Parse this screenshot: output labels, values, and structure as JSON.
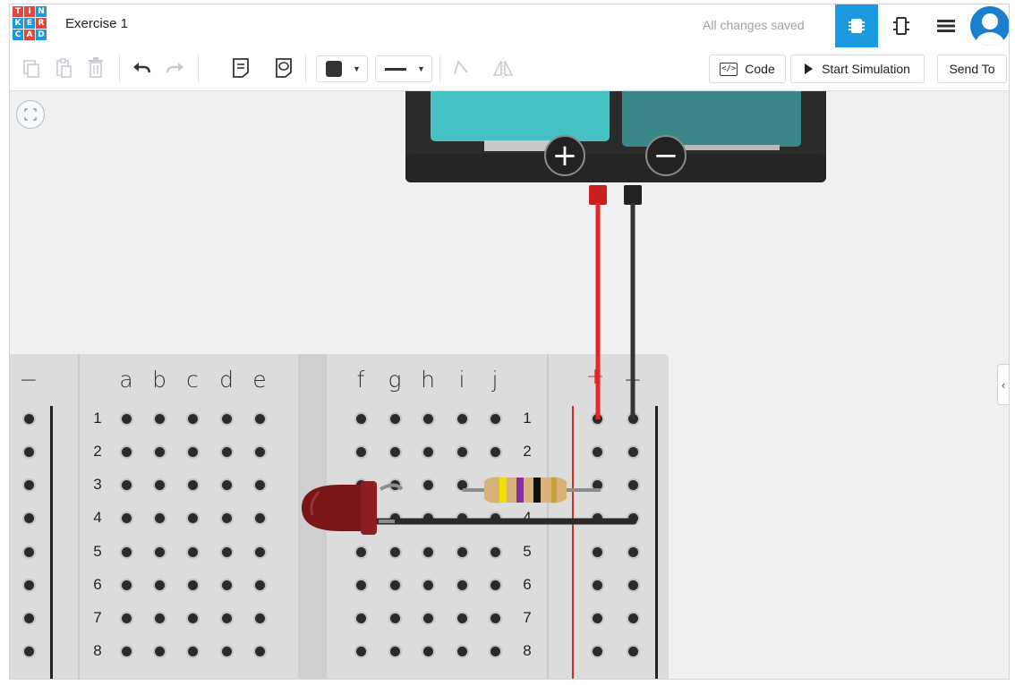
{
  "app": {
    "logo_letters": [
      "T",
      "I",
      "N",
      "K",
      "E",
      "R",
      "C",
      "A",
      "D"
    ],
    "logo_colors": [
      "#e4463a",
      "#e4463a",
      "#1c9ae0",
      "#1c9ae0",
      "#1c9ae0",
      "#e4463a",
      "#1c9ae0",
      "#e4463a",
      "#1c9ae0"
    ],
    "project_title": "Exercise 1",
    "save_status": "All changes saved",
    "view_buttons": [
      "circuit-view-icon",
      "schematic-view-icon",
      "component-list-icon"
    ],
    "active_view": "circuit-view-icon"
  },
  "toolbar": {
    "tools": [
      "copy-icon",
      "paste-icon",
      "delete-icon",
      "undo-icon",
      "redo-icon",
      "notes-icon",
      "notes-visibility-icon"
    ],
    "fill_color": "#333333",
    "line_style": "solid",
    "extra_tools": [
      "rotate-icon",
      "flip-icon"
    ],
    "code_label": "Code",
    "simulate_label": "Start Simulation",
    "send_label": "Send To"
  },
  "breadboard": {
    "left_rail_label": "−",
    "left_columns": [
      "a",
      "b",
      "c",
      "d",
      "e"
    ],
    "right_columns": [
      "f",
      "g",
      "h",
      "i",
      "j"
    ],
    "plus_label": "+",
    "minus_label": "−",
    "row_numbers": [
      "1",
      "2",
      "3",
      "4",
      "5",
      "6",
      "7",
      "8"
    ]
  },
  "components": {
    "battery": {
      "positive_symbol": "+",
      "negative_symbol": "−"
    },
    "resistor_bands": [
      "#f2e000",
      "#8a2f9e",
      "#111111",
      "#c9a23a"
    ],
    "led_color": "#7a1518",
    "wire_colors": {
      "positive": "#e32727",
      "negative": "#333333"
    }
  },
  "colors": {
    "accent": "#1c9ae0",
    "board": "#dcdcdc",
    "canvas": "#eef0f1"
  }
}
